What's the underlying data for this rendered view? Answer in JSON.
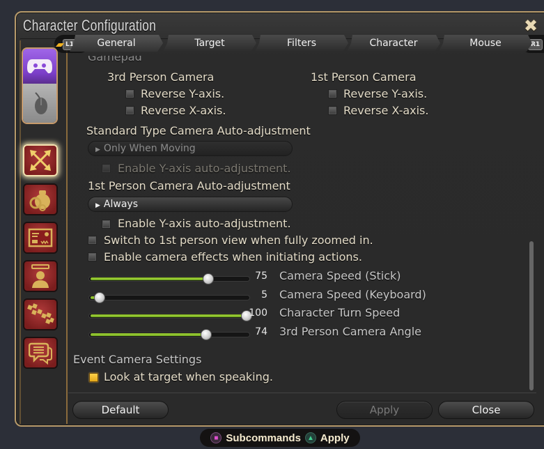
{
  "window": {
    "title": "Character Configuration",
    "close_icon": "ornate-close-icon"
  },
  "shoulder": {
    "left": "L1",
    "right": "R1"
  },
  "tabs": [
    {
      "label": "General",
      "active": true
    },
    {
      "label": "Target",
      "active": false
    },
    {
      "label": "Filters",
      "active": false
    },
    {
      "label": "Character",
      "active": false
    },
    {
      "label": "Mouse",
      "active": false
    }
  ],
  "mode_toggle": {
    "top_icon": "gamepad-icon",
    "bottom_icon": "mouse-icon",
    "active": "gamepad"
  },
  "sidebar": {
    "items": [
      {
        "icon": "camera-arrows-icon",
        "active": true
      },
      {
        "icon": "item-bag-gears-icon",
        "active": false
      },
      {
        "icon": "id-card-icon",
        "active": false
      },
      {
        "icon": "profile-icon",
        "active": false
      },
      {
        "icon": "hotbar-icon",
        "active": false
      },
      {
        "icon": "chat-bubbles-icon",
        "active": false
      }
    ]
  },
  "content": {
    "section_partial": "Gamepad",
    "third_person": {
      "heading": "3rd Person Camera",
      "reverse_y": {
        "label": "Reverse Y-axis.",
        "checked": false
      },
      "reverse_x": {
        "label": "Reverse X-axis.",
        "checked": false
      }
    },
    "first_person": {
      "heading": "1st Person Camera",
      "reverse_y": {
        "label": "Reverse Y-axis.",
        "checked": false
      },
      "reverse_x": {
        "label": "Reverse X-axis.",
        "checked": false
      }
    },
    "standard_auto": {
      "heading": "Standard Type Camera Auto-adjustment",
      "dropdown_value": "Only When Moving",
      "enable_y": {
        "label": "Enable Y-axis auto-adjustment.",
        "checked": false,
        "disabled": true
      }
    },
    "first_auto": {
      "heading": "1st Person Camera Auto-adjustment",
      "dropdown_value": "Always",
      "enable_y": {
        "label": "Enable Y-axis auto-adjustment.",
        "checked": false,
        "disabled": false
      }
    },
    "switch_first": {
      "label": "Switch to 1st person view when fully zoomed in.",
      "checked": false
    },
    "camera_effects": {
      "label": "Enable camera effects when initiating actions.",
      "checked": false
    },
    "sliders": [
      {
        "label": "Camera Speed (Stick)",
        "value": 75,
        "display": "75"
      },
      {
        "label": "Camera Speed (Keyboard)",
        "value": 5,
        "display": "5"
      },
      {
        "label": "Character Turn Speed",
        "value": 100,
        "display": "100"
      },
      {
        "label": "3rd Person Camera Angle",
        "value": 74,
        "display": "74"
      }
    ],
    "event_camera": {
      "heading": "Event Camera Settings",
      "look_at_target": {
        "label": "Look at target when speaking.",
        "checked": true
      }
    }
  },
  "footer": {
    "default_label": "Default",
    "apply_label": "Apply",
    "close_label": "Close"
  },
  "hints": {
    "square_icon": "square-button-icon",
    "square_label": "Subcommands",
    "triangle_icon": "triangle-button-icon",
    "triangle_label": "Apply"
  }
}
